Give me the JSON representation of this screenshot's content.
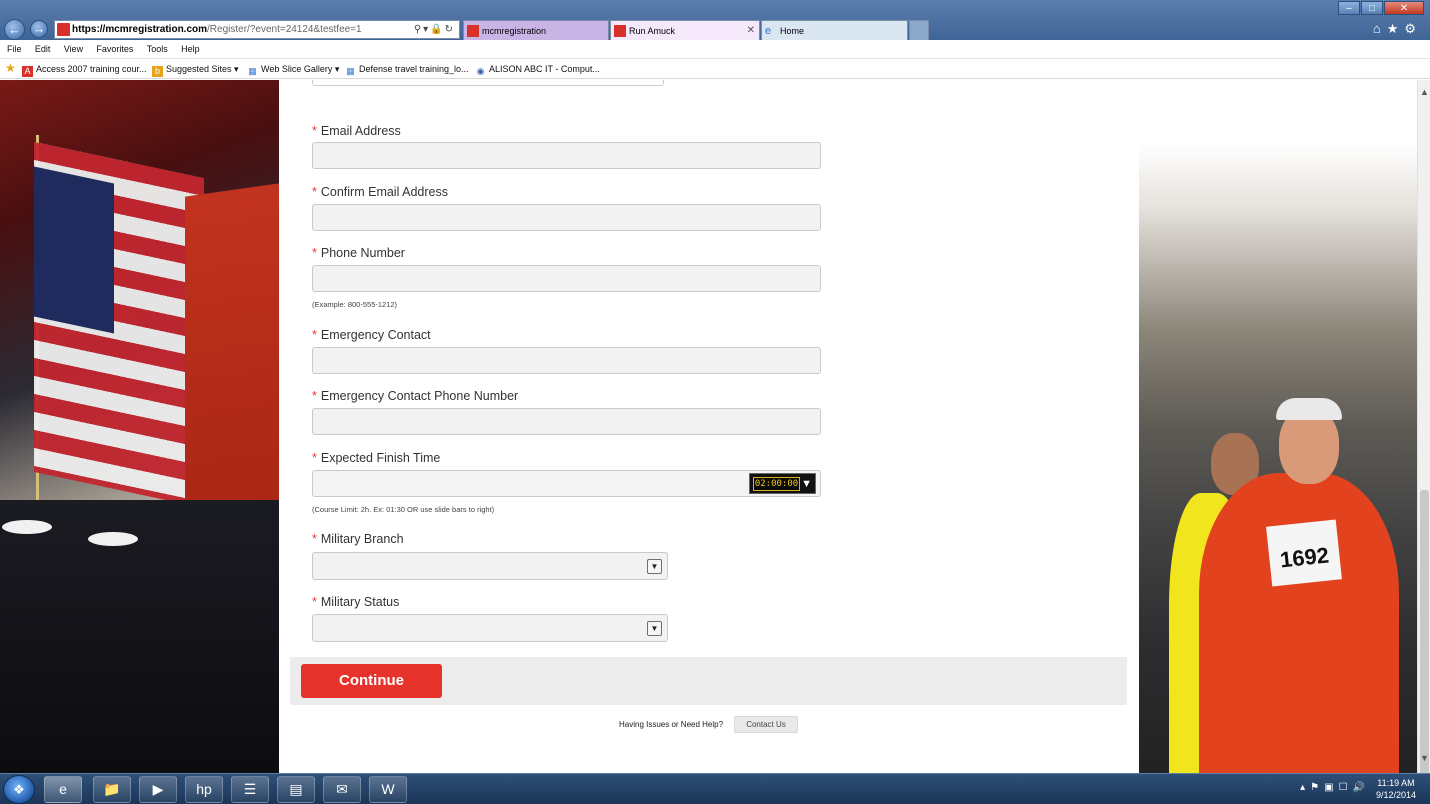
{
  "browser": {
    "url_domain": "https://mcmregistration.com",
    "url_path": "/Register/?event=24124&testfee=1",
    "tabs": [
      {
        "label": "mcmregistration",
        "active": false
      },
      {
        "label": "Run Amuck",
        "active": true
      },
      {
        "label": "Home",
        "active": false
      }
    ],
    "menu": [
      "File",
      "Edit",
      "View",
      "Favorites",
      "Tools",
      "Help"
    ],
    "favorites": [
      "Access 2007 training cour...",
      "Suggested Sites ▾",
      "Web Slice Gallery ▾",
      "Defense travel training_lo...",
      "ALISON ABC IT - Comput..."
    ]
  },
  "form": {
    "required_marker": "*",
    "fields": [
      {
        "label": "Email Address",
        "value": ""
      },
      {
        "label": "Confirm Email Address",
        "value": ""
      },
      {
        "label": "Phone Number",
        "value": "",
        "hint": "(Example: 800-555-1212)"
      },
      {
        "label": "Emergency Contact",
        "value": ""
      },
      {
        "label": "Emergency Contact Phone Number",
        "value": ""
      },
      {
        "label": "Expected Finish Time",
        "value": "",
        "timer": "02:00:00",
        "hint": "(Course Limit: 2h. Ex: 01:30 OR use slide bars to right)"
      }
    ],
    "selects": [
      {
        "label": "Military Branch",
        "value": ""
      },
      {
        "label": "Military Status",
        "value": ""
      }
    ],
    "continue_label": "Continue",
    "help_text": "Having Issues or Need Help?",
    "contact_label": "Contact Us"
  },
  "photo": {
    "bib_number": "1692"
  },
  "taskbar": {
    "time": "11:19 AM",
    "date": "9/12/2014"
  },
  "colors": {
    "accent": "#e5322b",
    "required": "#e43b2e",
    "field_bg": "#f2f2f2"
  }
}
